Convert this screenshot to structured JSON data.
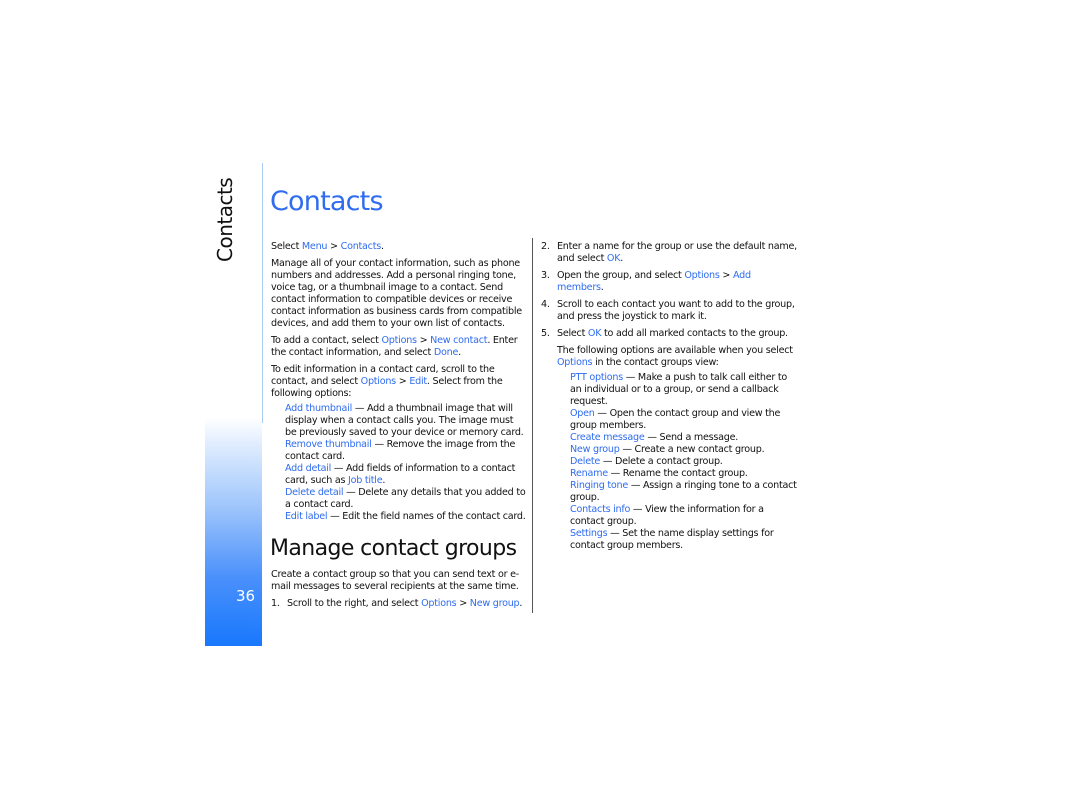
{
  "side_tab": {
    "label": "Contacts",
    "page_number": "36"
  },
  "colors": {
    "accent": "#2f6cf0",
    "rail_gradient_end": "#1878fc"
  },
  "section1": {
    "title": "Contacts",
    "select_prefix": "Select ",
    "select_menu": "Menu",
    "sep": " > ",
    "select_contacts": "Contacts",
    "select_suffix": ".",
    "intro": "Manage all of your contact information, such as phone numbers and addresses. Add a personal ringing tone, voice tag, or a thumbnail image to a contact. Send contact information to compatible devices or receive contact information as business cards from compatible devices, and add them to your own list of contacts.",
    "add_prefix": "To add a contact, select ",
    "add_options": "Options",
    "add_new": "New contact",
    "add_mid": ". Enter the contact information, and select ",
    "add_done": "Done",
    "add_suffix": ".",
    "edit_prefix": "To edit information in a contact card, scroll to the contact, and select ",
    "edit_options": "Options",
    "edit_edit": "Edit",
    "edit_suffix": ". Select from the following options:",
    "options": [
      {
        "name": "Add thumbnail",
        "desc": " — Add a thumbnail image that will display when a contact calls you. The image must be previously saved to your device or memory card."
      },
      {
        "name": "Remove thumbnail",
        "desc": " — Remove the image from the contact card."
      },
      {
        "name": "Add detail",
        "desc": " — Add fields of information to a contact card, such as ",
        "link": "Job title",
        "after": "."
      },
      {
        "name": "Delete detail",
        "desc": " — Delete any details that you added to a contact card."
      },
      {
        "name": "Edit label",
        "desc": " — Edit the field names of the contact card."
      }
    ]
  },
  "section2": {
    "title": "Manage contact groups",
    "intro": "Create a contact group so that you can send text or e-mail messages to several recipients at the same time.",
    "steps": [
      {
        "num": "1.",
        "prefix": "Scroll to the right, and select ",
        "l1": "Options",
        "l2": "New group",
        "suffix": "."
      },
      {
        "num": "2.",
        "prefix": "Enter a name for the group or use the default name, and select ",
        "l1": "OK",
        "suffix": "."
      },
      {
        "num": "3.",
        "prefix": "Open the group, and select ",
        "l1": "Options",
        "l2": "Add members",
        "suffix": "."
      },
      {
        "num": "4.",
        "prefix": "Scroll to each contact you want to add to the group, and press the joystick to mark it."
      },
      {
        "num": "5.",
        "prefix": "Select ",
        "l1": "OK",
        "suffix": " to add all marked contacts to the group."
      }
    ],
    "view_prefix": "The following options are available when you select ",
    "view_options": "Options",
    "view_suffix": " in the contact groups view:",
    "group_options": [
      {
        "name": "PTT options",
        "desc": " — Make a push to talk call either to an individual or to a group, or send a callback request."
      },
      {
        "name": "Open",
        "desc": " — Open the contact group and view the group members."
      },
      {
        "name": "Create message",
        "desc": " — Send a message."
      },
      {
        "name": "New group",
        "desc": " — Create a new contact group."
      },
      {
        "name": "Delete",
        "desc": " — Delete a contact group."
      },
      {
        "name": "Rename",
        "desc": " — Rename the contact group."
      },
      {
        "name": "Ringing tone",
        "desc": " — Assign a ringing tone to a contact group."
      },
      {
        "name": "Contacts info",
        "desc": " — View the information for a contact group."
      },
      {
        "name": "Settings",
        "desc": " — Set the name display settings for contact group members."
      }
    ]
  }
}
